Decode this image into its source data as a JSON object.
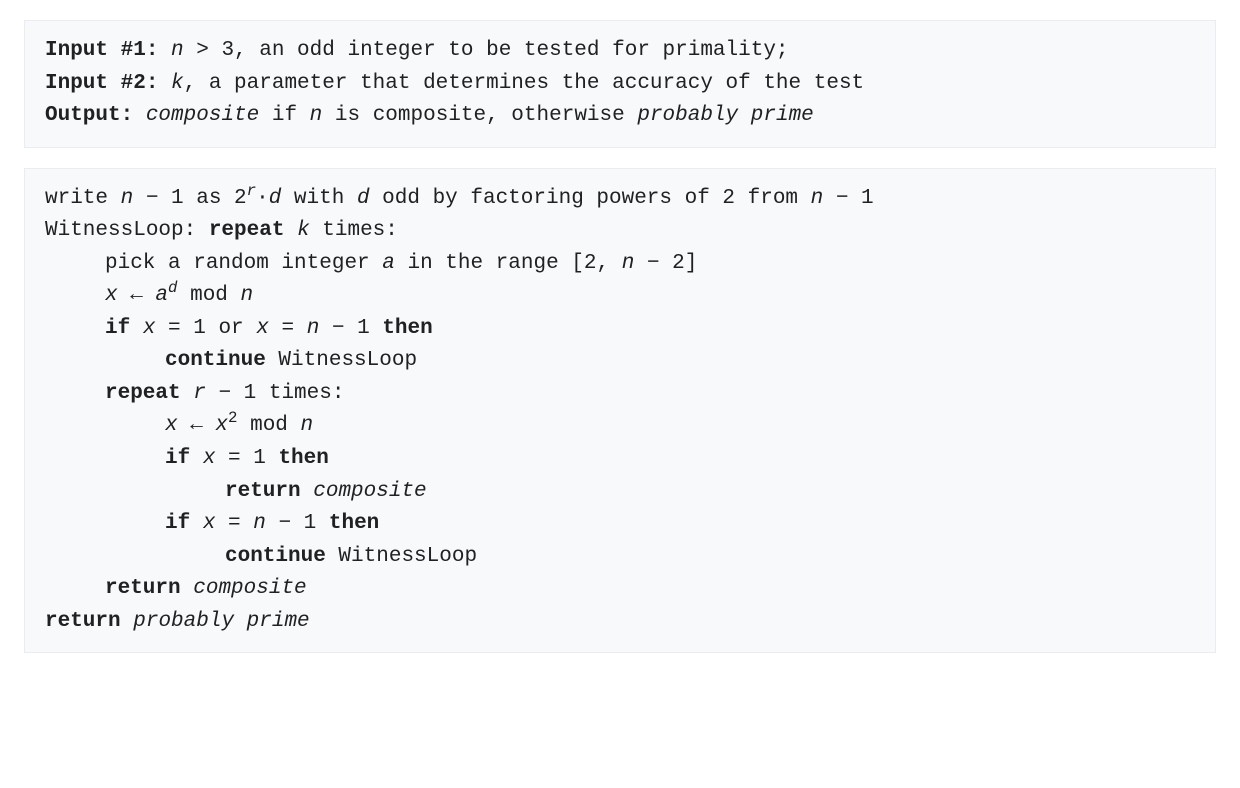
{
  "block1": {
    "input1_label": "Input #1:",
    "n": "n",
    "gt3": " > 3, an odd integer to be tested for primality;",
    "input2_label": "Input #2:",
    "k": "k",
    "k_desc": ", a parameter that determines the accuracy of the test",
    "output_label": "Output:",
    "composite": "composite",
    "if_text": " if ",
    "n2": "n",
    "iscomp": " is composite, otherwise ",
    "probprime": "probably prime"
  },
  "block2": {
    "l1": {
      "write": "write ",
      "n": "n",
      "minus1as": " − 1 as 2",
      "r": "r",
      "dot": "·",
      "d": "d",
      "with": " with ",
      "d2": "d",
      "odd": " odd by factoring powers of 2 from ",
      "n2": "n",
      "minus1": " − 1"
    },
    "l2": {
      "wl": "WitnessLoop: ",
      "repeat": "repeat",
      "sp": " ",
      "k": "k",
      "times": " times:"
    },
    "l3": {
      "pick": "pick a random integer ",
      "a": "a",
      "range": " in the range [2, ",
      "n": "n",
      "end": " − 2]"
    },
    "l4": {
      "x": "x",
      "assign": " ← ",
      "a": "a",
      "d": "d",
      "mod": " mod ",
      "n": "n"
    },
    "l5": {
      "if": "if",
      "sp": " ",
      "x": "x",
      "eq1or": " = 1 or ",
      "x2": "x",
      "eq": " = ",
      "n": "n",
      "minus1": " − 1 ",
      "then": "then"
    },
    "l6": {
      "continue": "continue",
      "wl": " WitnessLoop"
    },
    "l7": {
      "repeat": "repeat",
      "sp": " ",
      "r": "r",
      "times": " − 1 times:"
    },
    "l8": {
      "x": "x",
      "assign": " ← ",
      "x2": "x",
      "two": "2",
      "mod": " mod ",
      "n": "n"
    },
    "l9": {
      "if": "if",
      "sp": " ",
      "x": "x",
      "eq1": " = 1 ",
      "then": "then"
    },
    "l10": {
      "return": "return",
      "sp": " ",
      "composite": "composite"
    },
    "l11": {
      "if": "if",
      "sp": " ",
      "x": "x",
      "eq": " = ",
      "n": "n",
      "minus1": " − 1 ",
      "then": "then"
    },
    "l12": {
      "continue": "continue",
      "wl": " WitnessLoop"
    },
    "l13": {
      "return": "return",
      "sp": " ",
      "composite": "composite"
    },
    "l14": {
      "return": "return",
      "sp": " ",
      "probprime": "probably prime"
    }
  }
}
